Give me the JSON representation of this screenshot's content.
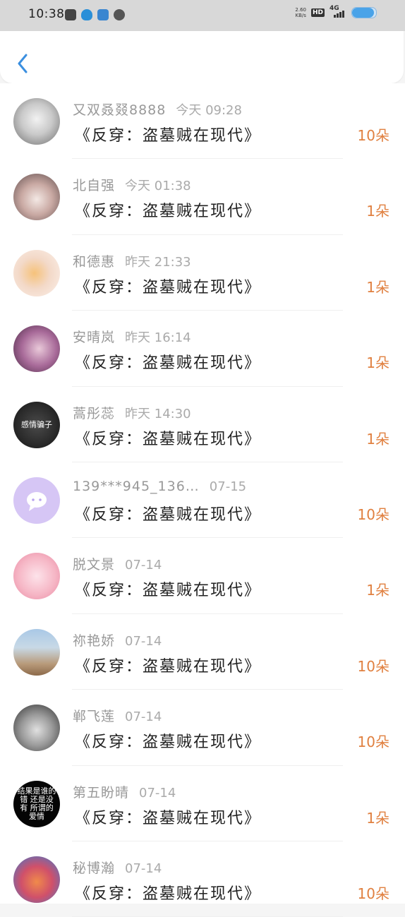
{
  "status_bar": {
    "time": "10:38",
    "net_speed_value": "2.60",
    "net_speed_unit": "KB/s",
    "hd": "HD",
    "network": "4G",
    "app_icons": [
      "gallery-icon",
      "qq-icon",
      "browser-icon",
      "wechat-icon"
    ],
    "battery_level": 0.9
  },
  "header": {
    "back_icon": "chevron-left-icon",
    "accent_color": "#3b8fe0"
  },
  "rows": [
    {
      "user": "又双叒叕8888",
      "time": "今天 09:28",
      "book": "《反穿：盗墓贼在现代》",
      "amount": "10朵",
      "avatar_text": "",
      "avatar_bg": "radial-gradient(circle at 50% 45%, #f2f2f2 0%, #c9c9c9 45%, #6d6d6d 100%)"
    },
    {
      "user": "北自强",
      "time": "今天 01:38",
      "book": "《反穿：盗墓贼在现代》",
      "amount": "1朵",
      "avatar_text": "",
      "avatar_bg": "radial-gradient(circle at 50% 55%, #f3e8e4 0%, #c9a9a3 45%, #5d4a4a 100%)"
    },
    {
      "user": "和德惠",
      "time": "昨天 21:33",
      "book": "《反穿：盗墓贼在现代》",
      "amount": "1朵",
      "avatar_text": "",
      "avatar_bg": "radial-gradient(circle at 45% 50%, #f6c27a 0%, #f3d9c8 45%, #fbf0ea 100%)"
    },
    {
      "user": "安晴岚",
      "time": "昨天 16:14",
      "book": "《反穿：盗墓贼在现代》",
      "amount": "1朵",
      "avatar_text": "",
      "avatar_bg": "radial-gradient(circle at 55% 50%, #e9c9d9 0%, #a86a99 50%, #4a2a45 100%)"
    },
    {
      "user": "蒿彤蕊",
      "time": "昨天 14:30",
      "book": "《反穿：盗墓贼在现代》",
      "amount": "1朵",
      "avatar_text": "感情骗子",
      "avatar_bg": "radial-gradient(circle at 50% 50%, #4a4a4a 0%, #2a2a2a 60%, #111 100%)"
    },
    {
      "user": "139***945_136…",
      "time": "07-15",
      "book": "《反穿：盗墓贼在现代》",
      "amount": "10朵",
      "avatar_text": "",
      "avatar_bg": "#d6c6f5"
    },
    {
      "user": "脱文景",
      "time": "07-14",
      "book": "《反穿：盗墓贼在现代》",
      "amount": "1朵",
      "avatar_text": "",
      "avatar_bg": "radial-gradient(circle at 50% 50%, #fde3ea 0%, #f6b7c6 55%, #e98aa3 100%)"
    },
    {
      "user": "祢艳娇",
      "time": "07-14",
      "book": "《反穿：盗墓贼在现代》",
      "amount": "10朵",
      "avatar_text": "",
      "avatar_bg": "linear-gradient(180deg, #a9c8e6 0%, #c8d9e6 40%, #b89a7a 75%, #8c6a4a 100%)"
    },
    {
      "user": "郸飞莲",
      "time": "07-14",
      "book": "《反穿：盗墓贼在现代》",
      "amount": "10朵",
      "avatar_text": "",
      "avatar_bg": "radial-gradient(circle at 50% 55%, #e0e0e0 0%, #9a9a9a 45%, #2e2e2e 100%)"
    },
    {
      "user": "第五盼晴",
      "time": "07-14",
      "book": "《反穿：盗墓贼在现代》",
      "amount": "1朵",
      "avatar_text": "结果是谁的错 还是没有 所谓的爱情",
      "avatar_bg": "#050505"
    },
    {
      "user": "秘博瀚",
      "time": "07-14",
      "book": "《反穿：盗墓贼在现代》",
      "amount": "10朵",
      "avatar_text": "",
      "avatar_bg": "radial-gradient(circle at 50% 55%, #f08a4a 0%, #d0506a 45%, #3a7ad0 100%)"
    }
  ]
}
